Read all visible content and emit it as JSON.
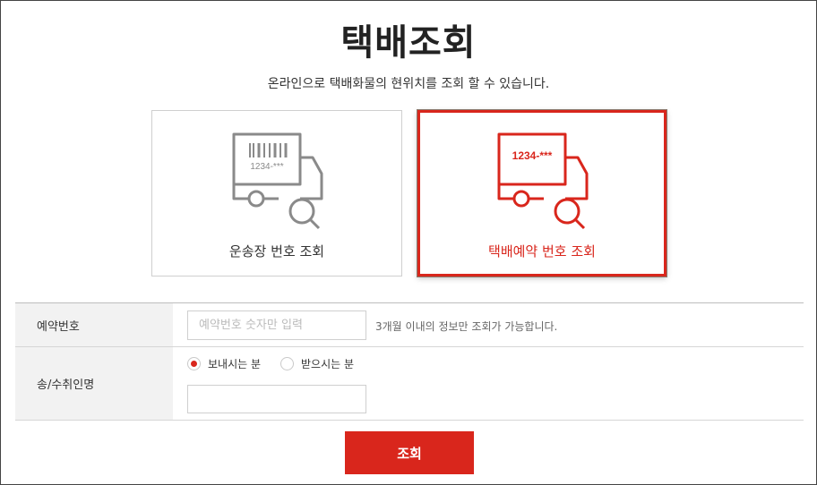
{
  "page": {
    "title": "택배조회",
    "subtitle": "온라인으로 택배화물의 현위치를 조회 할 수 있습니다."
  },
  "cards": [
    {
      "label": "운송장 번호 조회",
      "icon": "truck-barcode-search-icon",
      "number_text": "1234-***",
      "selected": false,
      "color": "#8a8a8a"
    },
    {
      "label": "택배예약 번호 조회",
      "icon": "truck-number-search-icon",
      "number_text": "1234-***",
      "selected": true,
      "color": "#d9261c"
    }
  ],
  "form": {
    "reservation_label": "예약번호",
    "reservation_placeholder": "예약번호 숫자만 입력",
    "reservation_hint": "3개월 이내의 정보만 조회가 가능합니다.",
    "name_label": "송/수취인명",
    "radio_sender": "보내시는 분",
    "radio_receiver": "받으시는 분",
    "radio_selected": "보내시는 분",
    "name_value": ""
  },
  "submit_label": "조회",
  "colors": {
    "accent": "#d9261c",
    "muted": "#8a8a8a"
  }
}
